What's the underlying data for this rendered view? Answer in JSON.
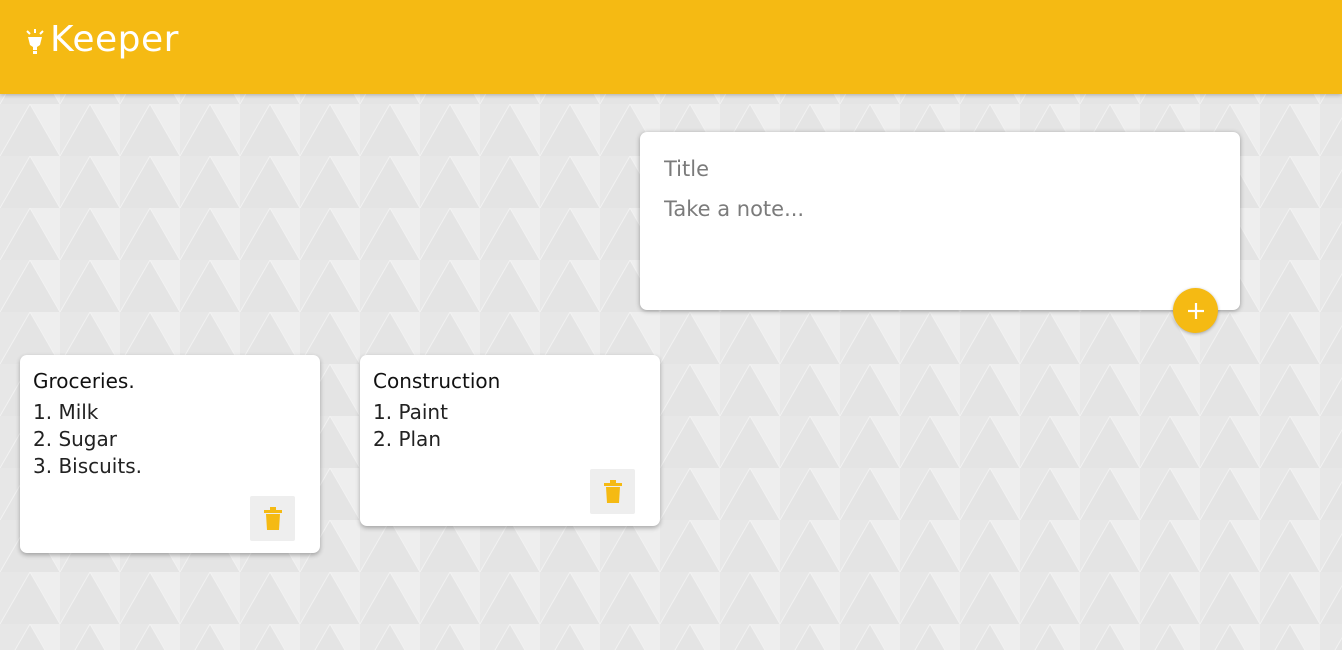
{
  "header": {
    "title": "Keeper",
    "icon": "lightbulb-icon",
    "background_color": "#f5ba13"
  },
  "create_note": {
    "title_placeholder": "Title",
    "content_placeholder": "Take a note...",
    "title_value": "",
    "content_value": "",
    "add_icon": "plus-icon"
  },
  "notes": [
    {
      "title": "Groceries.",
      "content": "1. Milk\n2. Sugar\n3. Biscuits.",
      "delete_icon": "trash-icon"
    },
    {
      "title": "Construction",
      "content": "1. Paint\n2. Plan",
      "delete_icon": "trash-icon"
    }
  ],
  "colors": {
    "accent": "#f5ba13",
    "background": "#eaeaea",
    "card": "#ffffff"
  }
}
